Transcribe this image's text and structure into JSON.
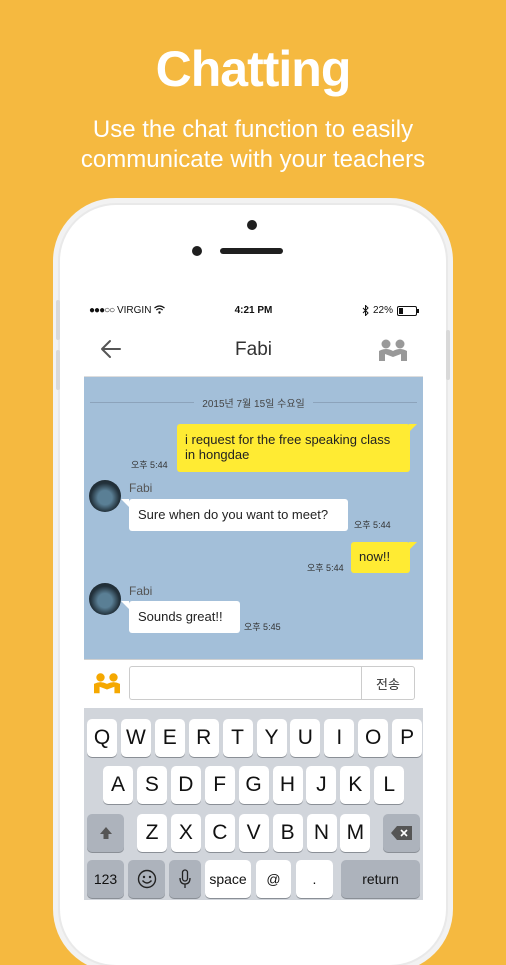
{
  "promo": {
    "title": "Chatting",
    "subtitle_line1": "Use the chat function to easily",
    "subtitle_line2": "communicate with your teachers"
  },
  "status_bar": {
    "signal_dots": "●●●○○",
    "carrier": "VIRGIN",
    "time": "4:21 PM",
    "battery": "22%",
    "battery_level": 0.22
  },
  "chat_header": {
    "title": "Fabi",
    "back_icon": "back-arrow-icon",
    "profile_icon": "people-icon"
  },
  "date_divider": "2015년 7월 15일 수요일",
  "messages": [
    {
      "from": "me",
      "text_line1": "i request for the free speaking class",
      "text_line2": "in hongdae",
      "time": "오후 5:44"
    },
    {
      "from": "them",
      "sender": "Fabi",
      "text": "Sure when do you want to meet?",
      "time": "오후 5:44"
    },
    {
      "from": "me",
      "text": "now!!",
      "time": "오후 5:44"
    },
    {
      "from": "them",
      "sender": "Fabi",
      "text": "Sounds great!!",
      "time": "오후 5:45"
    }
  ],
  "composer": {
    "placeholder": "",
    "send_label": "전송",
    "emoticon_icon": "people-icon"
  },
  "keyboard": {
    "row1": [
      "Q",
      "W",
      "E",
      "R",
      "T",
      "Y",
      "U",
      "I",
      "O",
      "P"
    ],
    "row2": [
      "A",
      "S",
      "D",
      "F",
      "G",
      "H",
      "J",
      "K",
      "L"
    ],
    "row3": [
      "Z",
      "X",
      "C",
      "V",
      "B",
      "N",
      "M"
    ],
    "num_label": "123",
    "space_label": "space",
    "at_label": "@",
    "dot_label": ".",
    "return_label": "return"
  },
  "colors": {
    "background": "#F5B940",
    "chat_bg": "#A3BFD9",
    "my_bubble": "#FFEB33",
    "their_bubble": "#FFFFFF",
    "keyboard_bg": "#D1D5DB"
  }
}
